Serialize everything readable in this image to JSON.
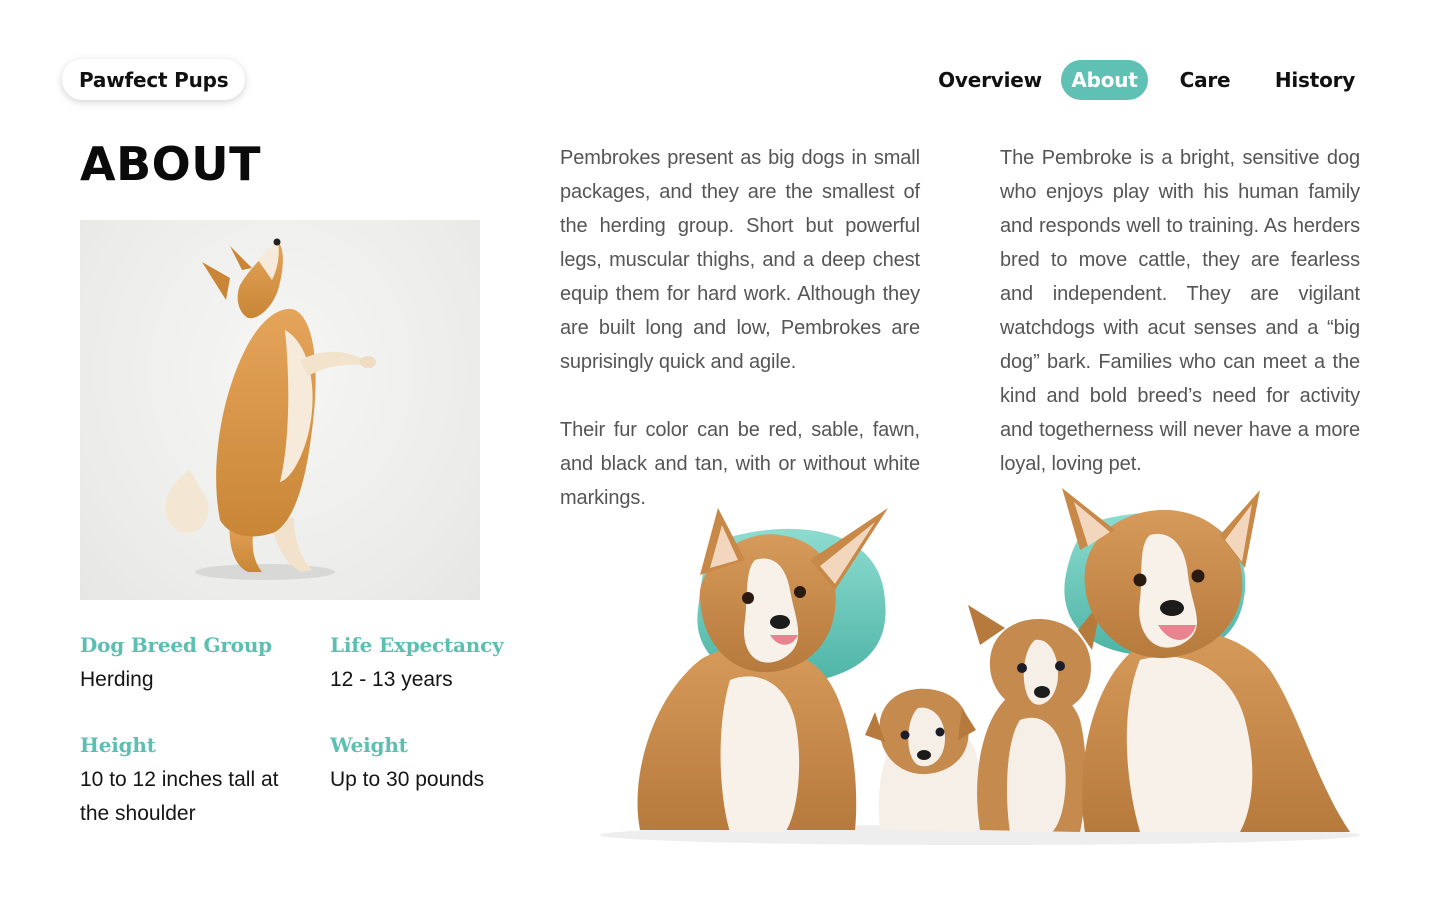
{
  "brand": {
    "name": "Pawfect Pups"
  },
  "nav": {
    "items": [
      {
        "label": "Overview",
        "active": false
      },
      {
        "label": "About",
        "active": true
      },
      {
        "label": "Care",
        "active": false
      },
      {
        "label": "History",
        "active": false
      }
    ]
  },
  "page": {
    "title": "ABOUT"
  },
  "facts": [
    {
      "label": "Dog Breed Group",
      "value": "Herding"
    },
    {
      "label": "Life Expectancy",
      "value": "12 - 13 years"
    },
    {
      "label": "Height",
      "value": "10 to 12 inches tall at the shoulder"
    },
    {
      "label": "Weight",
      "value": "Up to 30 pounds"
    }
  ],
  "content": {
    "column1": [
      "Pembrokes present as big dogs in small packages, and they are the smallest of the herding group. Short but powerful legs, muscular thighs, and a deep chest equip them for hard work. Although they are built long and low, Pembrokes are suprisingly quick and agile.",
      "Their fur color can be red, sable, fawn, and black and tan, with or without white markings."
    ],
    "column2": [
      "The Pembroke is a bright, sensitive dog who enjoys play with his human family and responds well to training. As herders bred to move cattle, they are fearless and independent. They are vigilant watchdogs with acut senses and a “big dog” bark. Families who can meet a the kind and bold breed’s need for activity and togetherness will never have a more loyal, loving pet."
    ]
  },
  "colors": {
    "accent": "#5ec1b4",
    "fact_label": "#5cbfb1",
    "body_text": "#555555",
    "heading": "#0a0a0a"
  },
  "icons": {
    "hero_photo": "jumping-corgi-photo",
    "family_photo": "corgi-family-photo"
  }
}
